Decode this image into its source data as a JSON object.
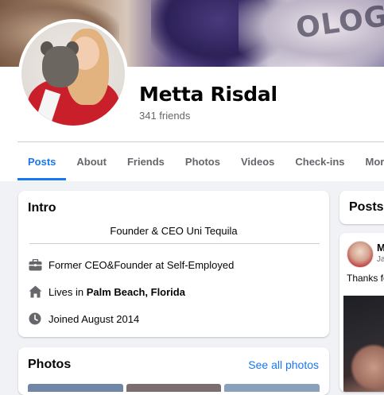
{
  "profile": {
    "name": "Metta Risdal",
    "friends_count": "341 friends"
  },
  "cover": {
    "visible_text": "OLOGE"
  },
  "tabs": [
    {
      "label": "Posts",
      "active": true
    },
    {
      "label": "About",
      "active": false
    },
    {
      "label": "Friends",
      "active": false
    },
    {
      "label": "Photos",
      "active": false
    },
    {
      "label": "Videos",
      "active": false
    },
    {
      "label": "Check-ins",
      "active": false
    },
    {
      "label": "More",
      "active": false
    }
  ],
  "intro": {
    "title": "Intro",
    "bio": "Founder & CEO Uni Tequila",
    "work": {
      "icon": "briefcase-icon",
      "text": "Former CEO&Founder at Self-Employed"
    },
    "lives": {
      "icon": "home-icon",
      "prefix": "Lives in ",
      "place": "Palm Beach, Florida"
    },
    "joined": {
      "icon": "clock-icon",
      "text": "Joined August 2014"
    }
  },
  "photos": {
    "title": "Photos",
    "see_all": "See all photos"
  },
  "posts": {
    "title": "Posts",
    "first_post": {
      "author_initial": "M",
      "date_fragment": "Ja",
      "text_fragment": "Thanks fo"
    }
  },
  "colors": {
    "accent": "#1877f2",
    "background": "#f0f2f5",
    "secondary_text": "#65676b",
    "icon_gray": "#65676b"
  }
}
